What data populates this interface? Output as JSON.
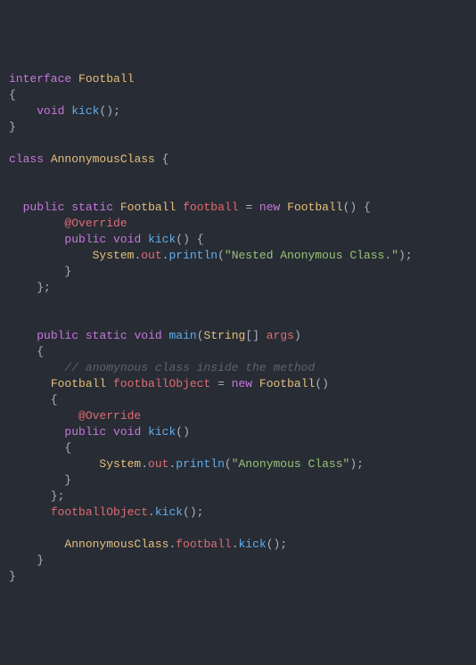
{
  "code": {
    "kw_interface": "interface",
    "kw_class": "class",
    "kw_public": "public",
    "kw_static": "static",
    "kw_void": "void",
    "kw_new": "new",
    "type_Football": "Football",
    "type_AnnonymousClass": "AnnonymousClass",
    "type_String": "String",
    "type_System": "System",
    "fn_kick": "kick",
    "fn_main": "main",
    "fn_println": "println",
    "ann_Override": "@Override",
    "var_football": "football",
    "var_footballObject": "footballObject",
    "var_args": "args",
    "var_out": "out",
    "str_nested": "\"Nested Anonymous Class.\"",
    "str_anon": "\"Anonymous Class\"",
    "cmt_method": "// anomynous class inside the method"
  }
}
